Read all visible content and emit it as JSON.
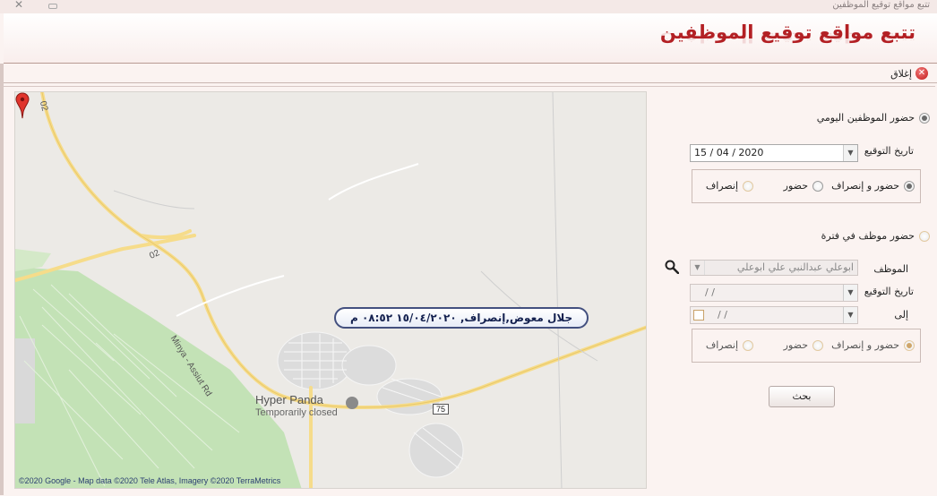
{
  "window": {
    "title": "تتبع مواقع توقيع الموظفين",
    "close_glyph": "✕"
  },
  "header": {
    "title": "تتبع مواقع توقيع الموظفين"
  },
  "toolbar": {
    "close_label": "إغلاق"
  },
  "map": {
    "callout_text": "جلال معوض,إنصراف, ١٥/٠٤/٢٠٢٠ ٠٨:٥٢ م",
    "poi_title": "Hyper Panda",
    "poi_subtitle": "Temporarily closed",
    "road_shield": "75",
    "road_02_a": "02",
    "road_02_b": "02",
    "road_minya": "Minya - Assiut Rd",
    "copyright": "©2020 Google - Map data ©2020 Tele Atlas, Imagery ©2020 TerraMetrics"
  },
  "panel": {
    "daily": {
      "label": "حضور الموظفين اليومي",
      "selected": true,
      "date_label": "تاريخ التوقيع",
      "date_value": "15 / 04 / 2020",
      "options": [
        {
          "label": "حضور و إنصراف",
          "selected": true
        },
        {
          "label": "حضور",
          "selected": false
        },
        {
          "label": "إنصراف",
          "selected": false
        }
      ]
    },
    "period": {
      "label": "حضور موظف في فترة",
      "selected": false,
      "employee_label": "الموظف",
      "employee_value": "ابوعلي عبدالنبي علي ابوعلي",
      "date_label": "تاريخ التوقيع",
      "date_from": "/      /",
      "to_label": "إلى",
      "date_to": "/      /",
      "options": [
        {
          "label": "حضور و إنصراف",
          "selected": true
        },
        {
          "label": "حضور",
          "selected": false
        },
        {
          "label": "إنصراف",
          "selected": false
        }
      ]
    },
    "search_button": "بحث"
  },
  "colors": {
    "title_red": "#b32024",
    "callout_border": "#43507f",
    "park_green": "#bfe0b3",
    "road_yellow": "#f6dc8a"
  }
}
